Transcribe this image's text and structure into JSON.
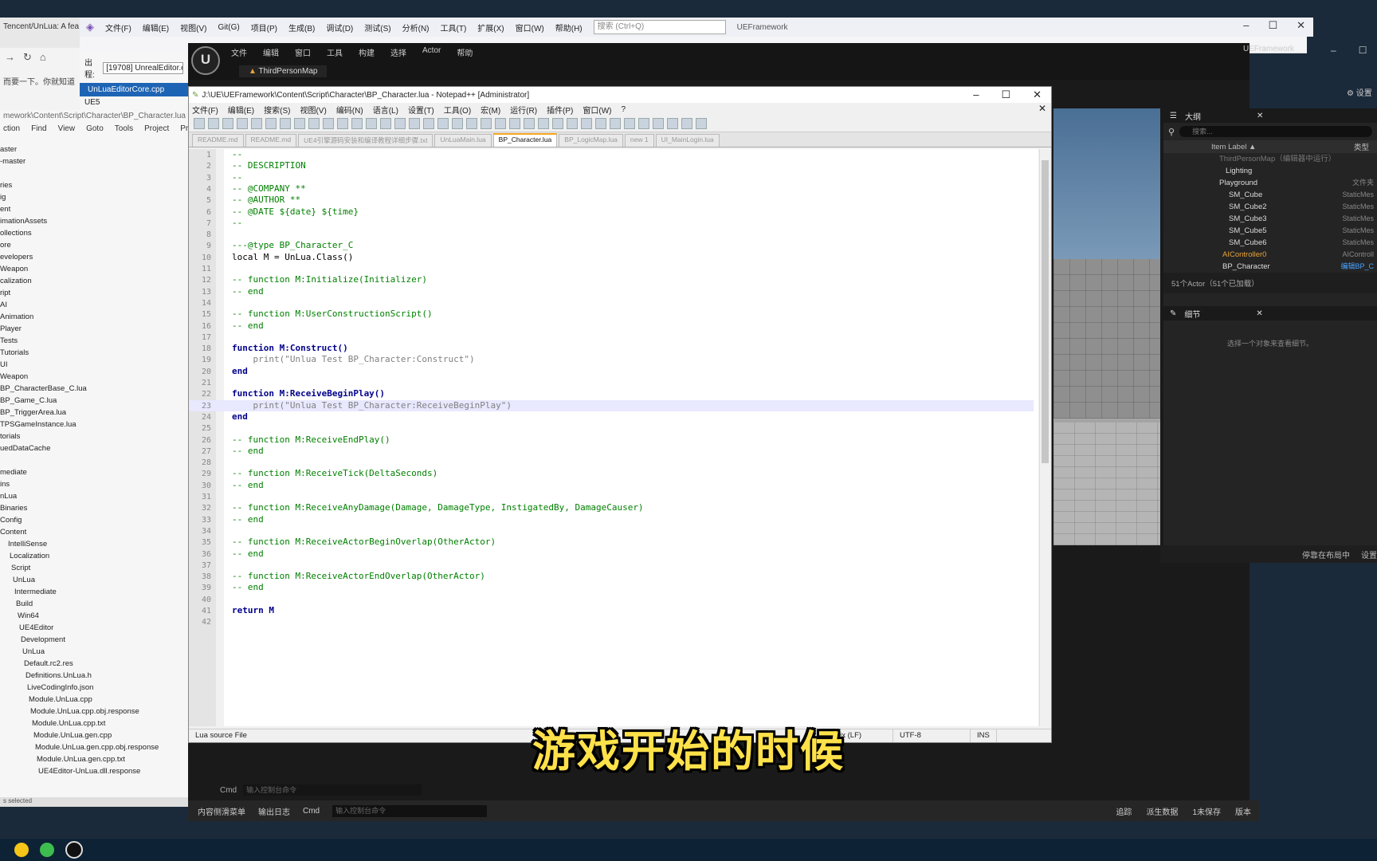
{
  "browser": {
    "tab_title": "Tencent/UnLua: A fea",
    "page_text": "而要一下。你就知道"
  },
  "vs": {
    "menu": [
      "文件(F)",
      "编辑(E)",
      "视图(V)",
      "Git(G)",
      "项目(P)",
      "生成(B)",
      "调试(D)",
      "测试(S)",
      "分析(N)",
      "工具(T)",
      "扩展(X)",
      "窗口(W)",
      "帮助(H)"
    ],
    "search_placeholder": "搜索 (Ctrl+Q)",
    "solution_name": "UEFramework",
    "output_label": "出程:",
    "output_value": "[19708] UnrealEditor.exe",
    "file_tab": "UnLuaEditorCore.cpp",
    "ue5_label": "UE5"
  },
  "solution": {
    "path": "mework\\Content\\Script\\Character\\BP_Character.lua (i",
    "menu": [
      "ction",
      "Find",
      "View",
      "Goto",
      "Tools",
      "Project",
      "Prefere"
    ],
    "items": [
      "aster",
      "-master",
      "",
      "ries",
      "ig",
      "ent",
      "imationAssets",
      "ollections",
      "ore",
      "evelopers",
      "Weapon",
      "calization",
      "ript",
      "AI",
      "Animation",
      "Player",
      "Tests",
      "Tutorials",
      "UI",
      "Weapon",
      "BP_CharacterBase_C.lua",
      "BP_Game_C.lua",
      "BP_TriggerArea.lua",
      "TPSGameInstance.lua",
      "torials",
      "uedDataCache",
      "",
      "mediate",
      "ins",
      "nLua",
      "Binaries",
      "Config",
      "Content",
      "IntelliSense",
      "Localization",
      "Script",
      "UnLua",
      "Intermediate",
      "Build",
      "Win64",
      "UE4Editor",
      "Development",
      "UnLua",
      "Default.rc2.res",
      "Definitions.UnLua.h",
      "LiveCodingInfo.json",
      "Module.UnLua.cpp",
      "Module.UnLua.cpp.obj.response",
      "Module.UnLua.cpp.txt",
      "Module.UnLua.gen.cpp",
      "Module.UnLua.gen.cpp.obj.response",
      "Module.UnLua.gen.cpp.txt",
      "UE4Editor-UnLua.dll.response"
    ],
    "status": "s selected"
  },
  "ue": {
    "menu": [
      "文件",
      "编辑",
      "窗口",
      "工具",
      "构建",
      "选择",
      "Actor",
      "帮助"
    ],
    "map_tab": "ThirdPersonMap",
    "title": "UEFramework",
    "settings": "设置",
    "outliner_tab": "大纲",
    "search_placeholder": "搜索...",
    "col_label": "Item Label ▲",
    "col_type": "类型",
    "outliner_rows": [
      {
        "label": "ThirdPersonMap（编辑器中运行）",
        "type": ""
      },
      {
        "label": "Lighting",
        "type": ""
      },
      {
        "label": "Playground",
        "type": "文件夹"
      },
      {
        "label": "SM_Cube",
        "type": "StaticMes"
      },
      {
        "label": "SM_Cube2",
        "type": "StaticMes"
      },
      {
        "label": "SM_Cube3",
        "type": "StaticMes"
      },
      {
        "label": "SM_Cube5",
        "type": "StaticMes"
      },
      {
        "label": "SM_Cube6",
        "type": "StaticMes"
      },
      {
        "label": "AIController0",
        "type": "AIControll"
      },
      {
        "label": "BP_Character",
        "type": "编辑BP_C"
      }
    ],
    "actor_count": "51个Actor（51个已加载）",
    "details_tab": "细节",
    "details_hint": "选择一个对象来查看细节。",
    "vp_bottom_1": "停靠在布局中",
    "vp_bottom_2": "设置",
    "cmd_label": "Cmd",
    "cmd_placeholder": "输入控制台命令",
    "bottom": {
      "content_drawer": "内容侧滑菜单",
      "output_log": "输出日志",
      "cmd": "Cmd",
      "cmd_placeholder": "输入控制台命令",
      "trace": "追踪",
      "derived": "派生数据",
      "unsaved": "1未保存",
      "version": "版本"
    }
  },
  "npp": {
    "title": "J:\\UE\\UEFramework\\Content\\Script\\Character\\BP_Character.lua - Notepad++ [Administrator]",
    "menu": [
      "文件(F)",
      "编辑(E)",
      "搜索(S)",
      "视图(V)",
      "编码(N)",
      "语言(L)",
      "设置(T)",
      "工具(O)",
      "宏(M)",
      "运行(R)",
      "插件(P)",
      "窗口(W)",
      "?"
    ],
    "tabs": [
      {
        "label": "README.md",
        "active": false
      },
      {
        "label": "README.md",
        "active": false
      },
      {
        "label": "UE4引擎源码安装和编译教程详细步骤.txt",
        "active": false
      },
      {
        "label": "UnLuaMain.lua",
        "active": false
      },
      {
        "label": "BP_Character.lua",
        "active": true
      },
      {
        "label": "BP_LogicMap.lua",
        "active": false
      },
      {
        "label": "new 1",
        "active": false
      },
      {
        "label": "UI_MainLogin.lua",
        "active": false
      }
    ],
    "lines": [
      {
        "n": "1",
        "t": "--",
        "k": "com"
      },
      {
        "n": "2",
        "t": "-- DESCRIPTION",
        "k": "com"
      },
      {
        "n": "3",
        "t": "--",
        "k": "com"
      },
      {
        "n": "4",
        "t": "-- @COMPANY **",
        "k": "com"
      },
      {
        "n": "5",
        "t": "-- @AUTHOR **",
        "k": "com"
      },
      {
        "n": "6",
        "t": "-- @DATE ${date} ${time}",
        "k": "com"
      },
      {
        "n": "7",
        "t": "--",
        "k": "com"
      },
      {
        "n": "8",
        "t": "",
        "k": "id"
      },
      {
        "n": "9",
        "t": "---@type BP_Character_C",
        "k": "com"
      },
      {
        "n": "10",
        "t": "local M = UnLua.Class()",
        "k": "id"
      },
      {
        "n": "11",
        "t": "",
        "k": "id"
      },
      {
        "n": "12",
        "t": "-- function M:Initialize(Initializer)",
        "k": "com"
      },
      {
        "n": "13",
        "t": "-- end",
        "k": "com"
      },
      {
        "n": "14",
        "t": "",
        "k": "id"
      },
      {
        "n": "15",
        "t": "-- function M:UserConstructionScript()",
        "k": "com"
      },
      {
        "n": "16",
        "t": "-- end",
        "k": "com"
      },
      {
        "n": "17",
        "t": "",
        "k": "id"
      },
      {
        "n": "18",
        "t": "function M:Construct()",
        "k": "kw"
      },
      {
        "n": "19",
        "t": "    print(\"Unlua Test BP_Character:Construct\")",
        "k": "str"
      },
      {
        "n": "20",
        "t": "end",
        "k": "kw"
      },
      {
        "n": "21",
        "t": "",
        "k": "id"
      },
      {
        "n": "22",
        "t": "function M:ReceiveBeginPlay()",
        "k": "kw"
      },
      {
        "n": "23",
        "t": "    print(\"Unlua Test BP_Character:ReceiveBeginPlay\")",
        "k": "str"
      },
      {
        "n": "24",
        "t": "end",
        "k": "kw"
      },
      {
        "n": "25",
        "t": "",
        "k": "id"
      },
      {
        "n": "26",
        "t": "-- function M:ReceiveEndPlay()",
        "k": "com"
      },
      {
        "n": "27",
        "t": "-- end",
        "k": "com"
      },
      {
        "n": "28",
        "t": "",
        "k": "id"
      },
      {
        "n": "29",
        "t": "-- function M:ReceiveTick(DeltaSeconds)",
        "k": "com"
      },
      {
        "n": "30",
        "t": "-- end",
        "k": "com"
      },
      {
        "n": "31",
        "t": "",
        "k": "id"
      },
      {
        "n": "32",
        "t": "-- function M:ReceiveAnyDamage(Damage, DamageType, InstigatedBy, DamageCauser)",
        "k": "com"
      },
      {
        "n": "33",
        "t": "-- end",
        "k": "com"
      },
      {
        "n": "34",
        "t": "",
        "k": "id"
      },
      {
        "n": "35",
        "t": "-- function M:ReceiveActorBeginOverlap(OtherActor)",
        "k": "com"
      },
      {
        "n": "36",
        "t": "-- end",
        "k": "com"
      },
      {
        "n": "37",
        "t": "",
        "k": "id"
      },
      {
        "n": "38",
        "t": "-- function M:ReceiveActorEndOverlap(OtherActor)",
        "k": "com"
      },
      {
        "n": "39",
        "t": "-- end",
        "k": "com"
      },
      {
        "n": "40",
        "t": "",
        "k": "id"
      },
      {
        "n": "41",
        "t": "return M",
        "k": "kw"
      },
      {
        "n": "42",
        "t": "",
        "k": "id"
      }
    ],
    "current_line": "23",
    "status": {
      "type": "Lua source File",
      "eol": "Unix (LF)",
      "encoding": "UTF-8",
      "mode": "INS"
    }
  },
  "subtitle": "游戏开始的时候",
  "colors": {
    "comment": "#008000",
    "keyword": "#00008b",
    "string": "#808080",
    "subtitle": "#ffe14a",
    "active_tab_accent": "#f5a623"
  }
}
